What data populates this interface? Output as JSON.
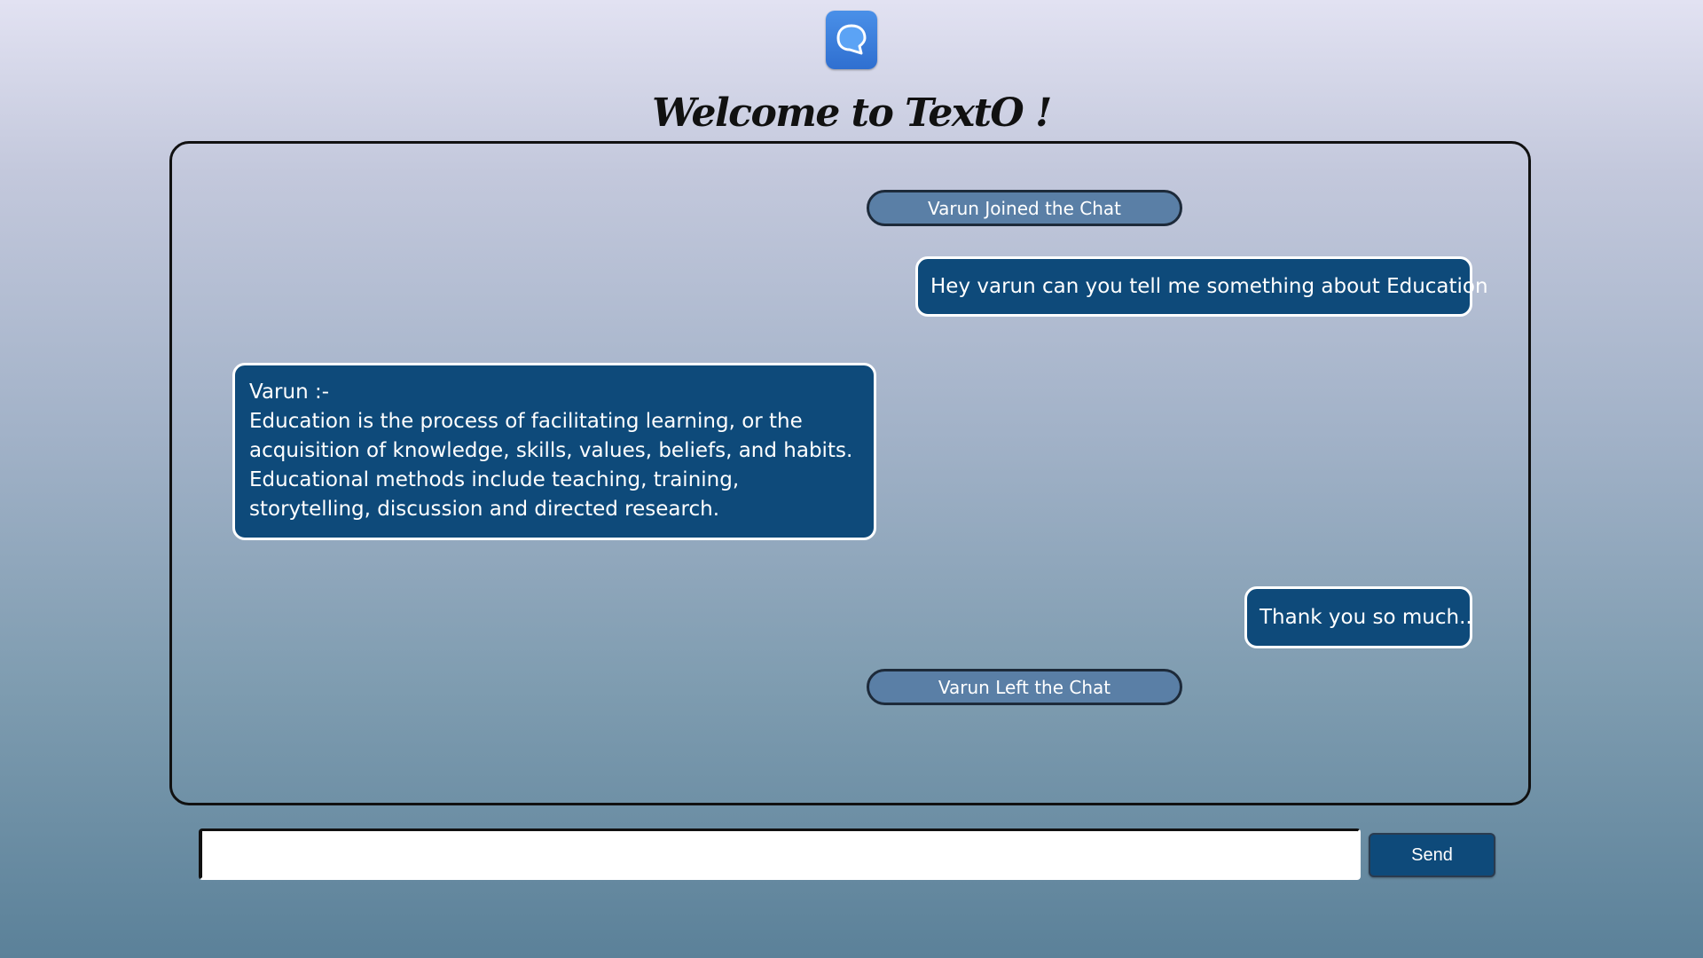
{
  "app": {
    "title": "Welcome to TextO !",
    "logo_icon": "chat-bubble-icon",
    "accent_color": "#0e4a7a",
    "logo_color": "#3b7fe0"
  },
  "chat": {
    "joined_notice": "Varun Joined the Chat",
    "left_notice": "Varun Left the Chat",
    "messages": [
      {
        "side": "outgoing",
        "text": "Hey varun can you tell me something about Education"
      },
      {
        "side": "incoming",
        "sender": "Varun :-",
        "text": "Education is the process of facilitating learning, or the acquisition of knowledge, skills, values, beliefs, and habits. Educational methods include teaching, training, storytelling, discussion and directed research."
      },
      {
        "side": "outgoing",
        "text": "Thank you so much.."
      }
    ]
  },
  "composer": {
    "input_value": "",
    "input_placeholder": "",
    "send_label": "Send"
  }
}
